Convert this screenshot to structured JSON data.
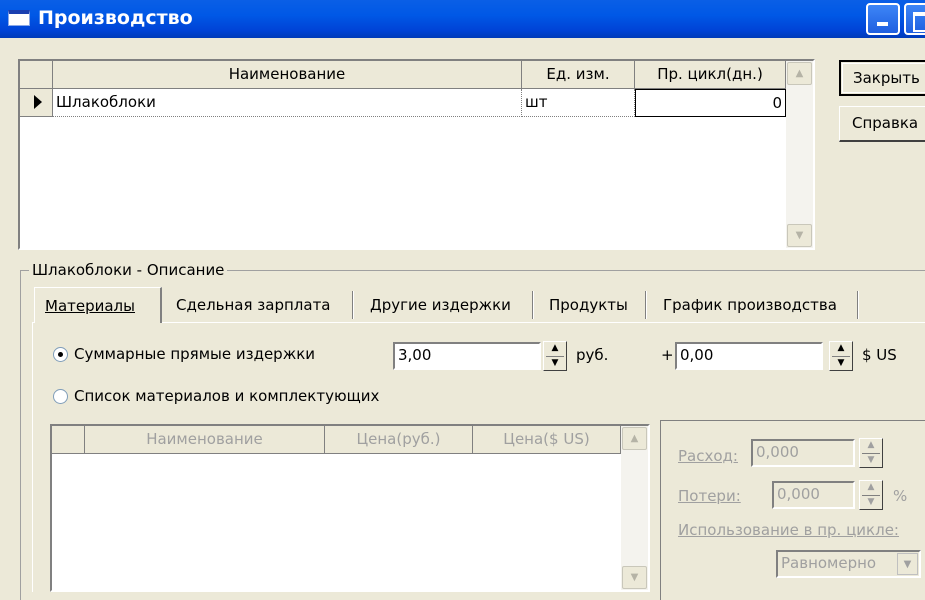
{
  "window": {
    "title": "Производство"
  },
  "buttons": {
    "close": "Закрыть",
    "help": "Справка"
  },
  "products_table": {
    "columns": [
      "Наименование",
      "Ед. изм.",
      "Пр. цикл(дн.)"
    ],
    "rows": [
      {
        "name": "Шлакоблоки",
        "unit": "шт",
        "cycle": "0"
      }
    ]
  },
  "description_group": {
    "label": "Шлакоблоки - Описание"
  },
  "tabs": [
    "Материалы",
    "Сдельная зарплата",
    "Другие издержки",
    "Продукты",
    "График производства"
  ],
  "materials": {
    "radio_total": "Суммарные прямые издержки",
    "radio_list": "Список материалов и комплектующих",
    "selected": "total",
    "rub_value": "3,00",
    "rub_unit": "руб.",
    "plus": "+",
    "usd_value": "0,00",
    "usd_unit": "$ US",
    "table_columns": [
      "Наименование",
      "Цена(руб.)",
      "Цена($ US)"
    ],
    "consumption_label": "Расход:",
    "consumption_value": "0,000",
    "losses_label": "Потери:",
    "losses_value": "0,000",
    "losses_unit": "%",
    "usage_label": "Использование в пр. цикле:",
    "usage_value": "Равномерно"
  }
}
